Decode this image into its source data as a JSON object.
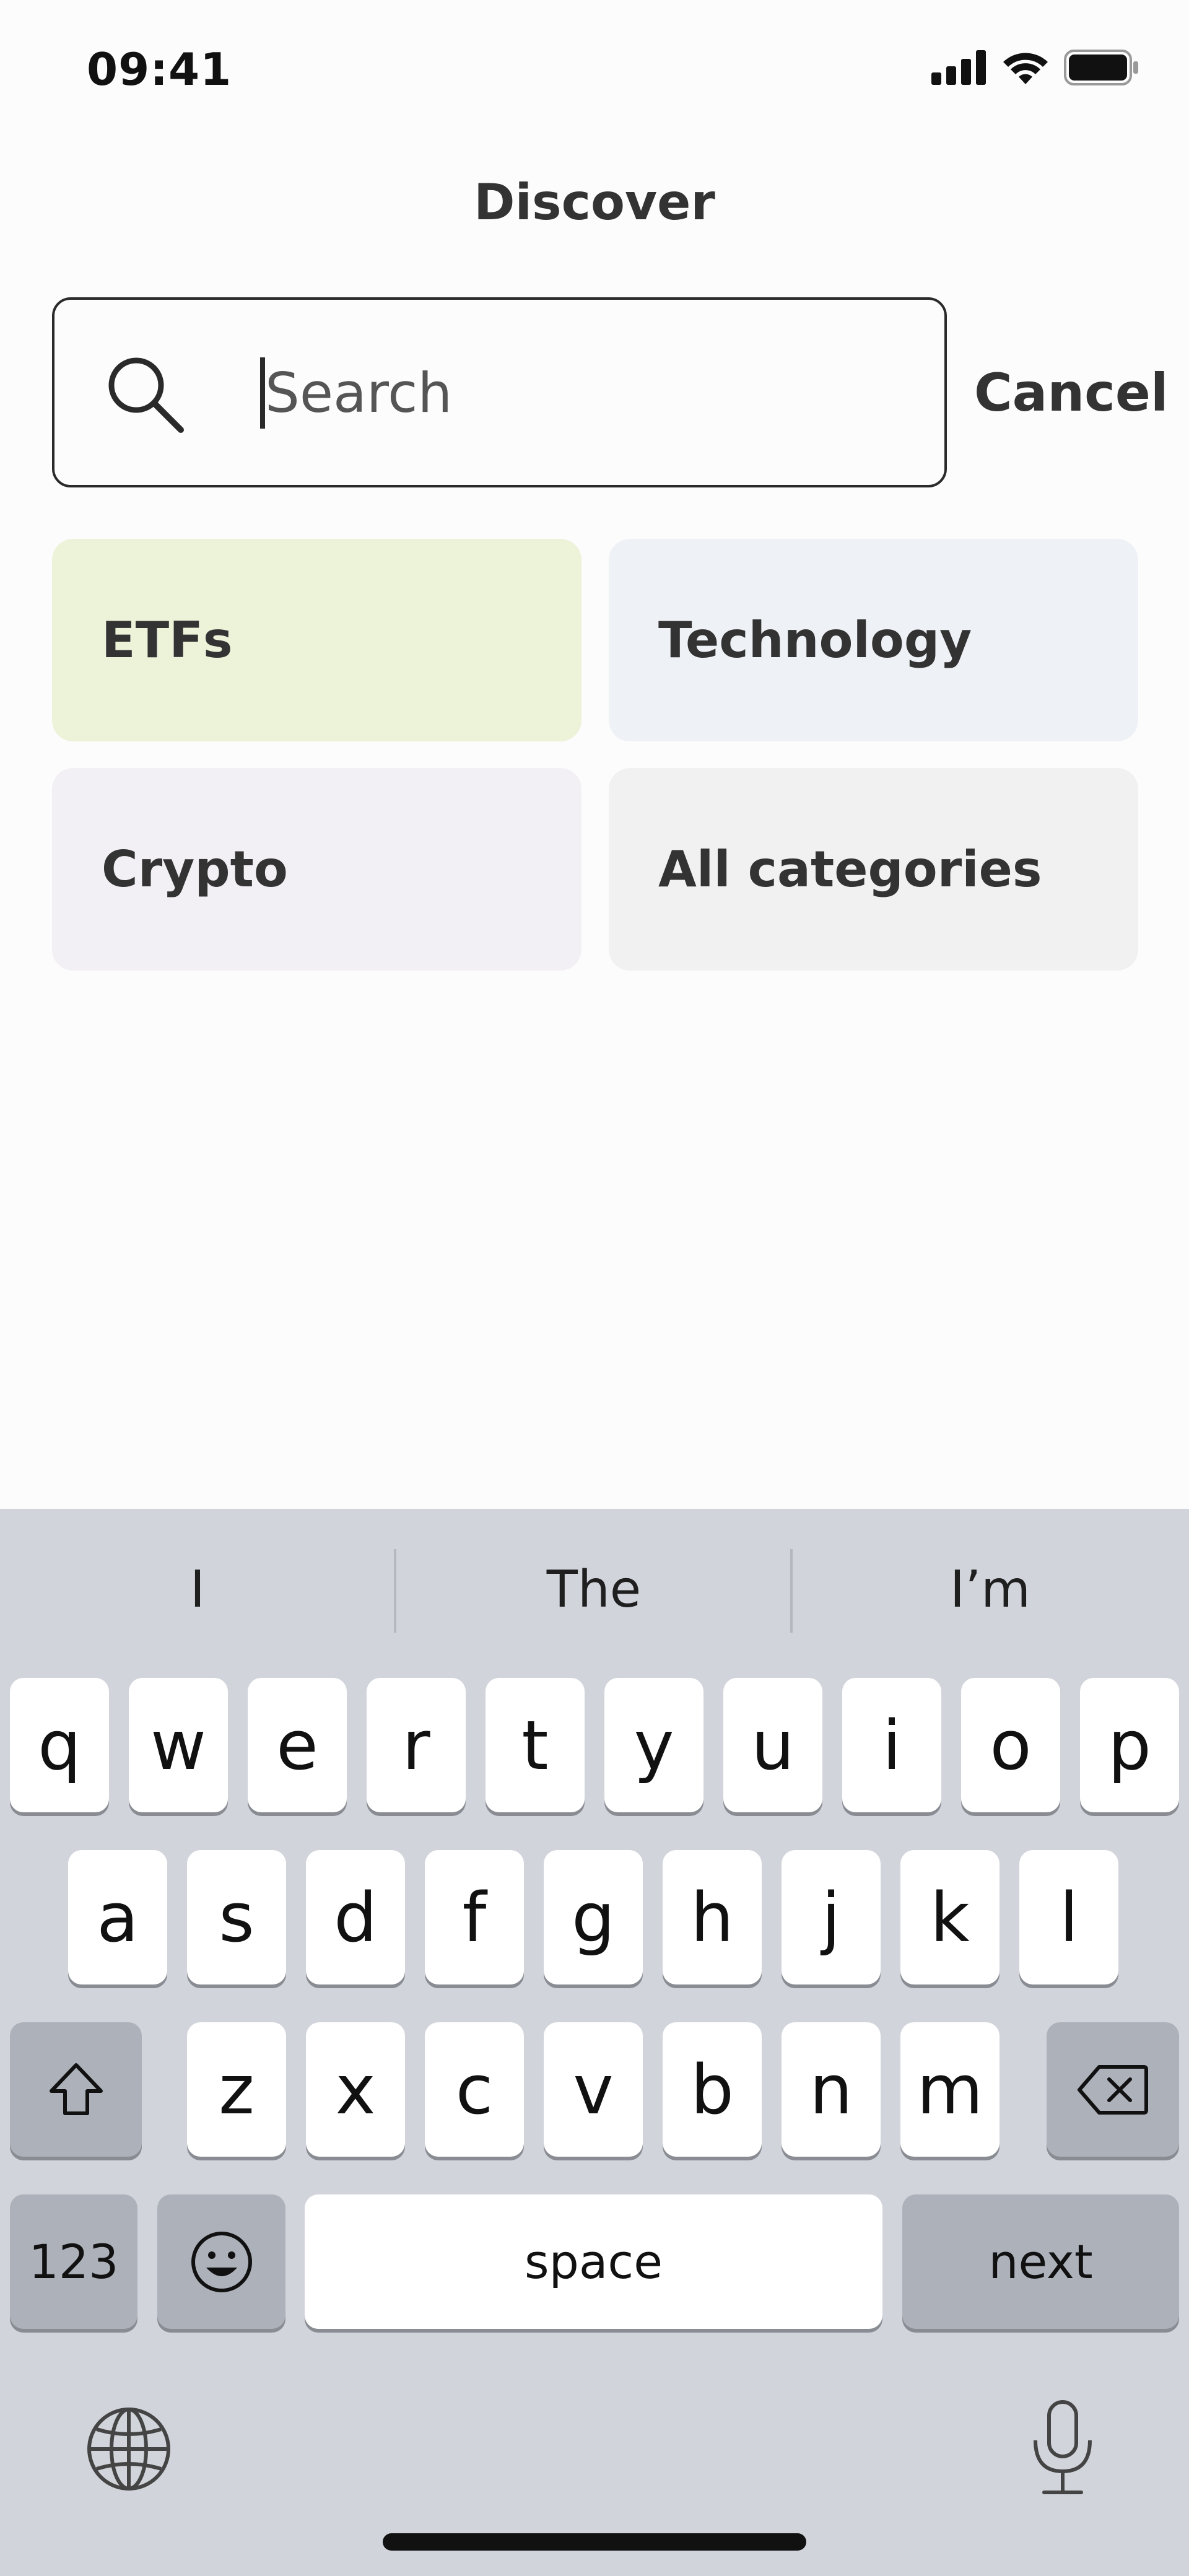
{
  "status_bar": {
    "time": "09:41"
  },
  "header": {
    "title": "Discover"
  },
  "search": {
    "placeholder": "Search",
    "value": "",
    "cancel_label": "Cancel"
  },
  "categories": [
    {
      "label": "ETFs",
      "color": "#ecf3d9"
    },
    {
      "label": "Technology",
      "color": "#eef2f6"
    },
    {
      "label": "Crypto",
      "color": "#f3f0f5"
    },
    {
      "label": "All categories",
      "color": "#f1f1f1"
    }
  ],
  "keyboard": {
    "suggestions": [
      "I",
      "The",
      "I’m"
    ],
    "row1": [
      "q",
      "w",
      "e",
      "r",
      "t",
      "y",
      "u",
      "i",
      "o",
      "p"
    ],
    "row2": [
      "a",
      "s",
      "d",
      "f",
      "g",
      "h",
      "j",
      "k",
      "l"
    ],
    "row3": [
      "z",
      "x",
      "c",
      "v",
      "b",
      "n",
      "m"
    ],
    "numbers_label": "123",
    "space_label": "space",
    "return_label": "next",
    "icons": [
      "shift-icon",
      "backspace-icon",
      "emoji-icon",
      "globe-icon",
      "microphone-icon"
    ]
  },
  "colors": {
    "keyboard_background": "#d1d4db",
    "key": "#ffffff",
    "function_key": "#acb1ba",
    "text": "#333333"
  }
}
